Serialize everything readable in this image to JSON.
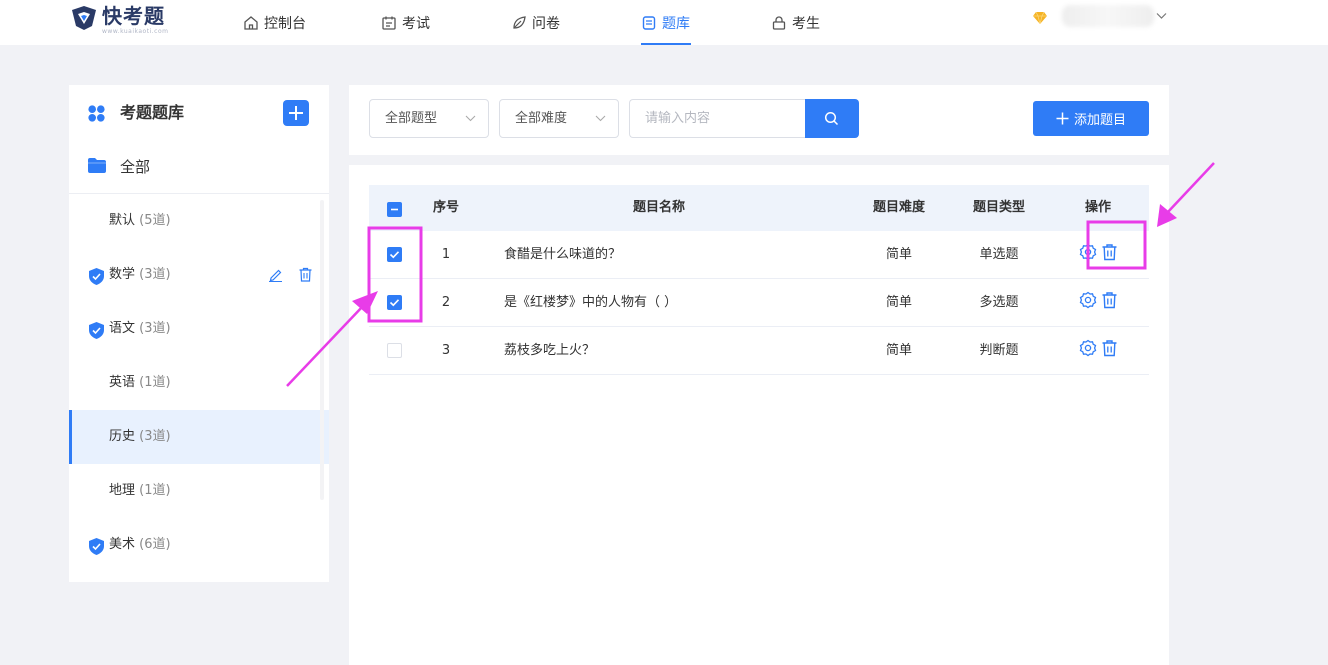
{
  "nav": {
    "logo_title": "快考题",
    "logo_sub": "www.kuaikaoti.com",
    "items": [
      {
        "label": "控制台",
        "icon": "home-icon"
      },
      {
        "label": "考试",
        "icon": "calendar-icon"
      },
      {
        "label": "问卷",
        "icon": "leaf-icon"
      },
      {
        "label": "题库",
        "icon": "document-icon"
      },
      {
        "label": "考生",
        "icon": "lock-icon"
      }
    ],
    "active": "题库"
  },
  "sidebar": {
    "title": "考题题库",
    "all_label": "全部",
    "categories": [
      {
        "name": "默认",
        "count": "(5道)"
      },
      {
        "name": "数学",
        "count": "(3道)"
      },
      {
        "name": "语文",
        "count": "(3道)"
      },
      {
        "name": "英语",
        "count": "(1道)"
      },
      {
        "name": "历史",
        "count": "(3道)"
      },
      {
        "name": "地理",
        "count": "(1道)"
      },
      {
        "name": "美术",
        "count": "(6道)"
      }
    ],
    "active": "历史"
  },
  "filters": {
    "type_select": "全部题型",
    "difficulty_select": "全部难度",
    "search_placeholder": "请输入内容",
    "add_question_label": "添加题目"
  },
  "table": {
    "headers": {
      "index": "序号",
      "name": "题目名称",
      "difficulty": "题目难度",
      "type": "题目类型",
      "actions": "操作"
    },
    "rows": [
      {
        "index": "1",
        "name": "食醋是什么味道的？",
        "difficulty": "简单",
        "type": "单选题",
        "checked": true
      },
      {
        "index": "2",
        "name": "是《红楼梦》中的人物有（  ）",
        "difficulty": "简单",
        "type": "多选题",
        "checked": true
      },
      {
        "index": "3",
        "name": "荔枝多吃上火？",
        "difficulty": "简单",
        "type": "判断题",
        "checked": false
      }
    ]
  },
  "colors": {
    "primary": "#2f7cf6",
    "annotation": "#e83ce8",
    "page_bg": "#f1f2f6",
    "active_item_bg": "#e8f1fe"
  }
}
